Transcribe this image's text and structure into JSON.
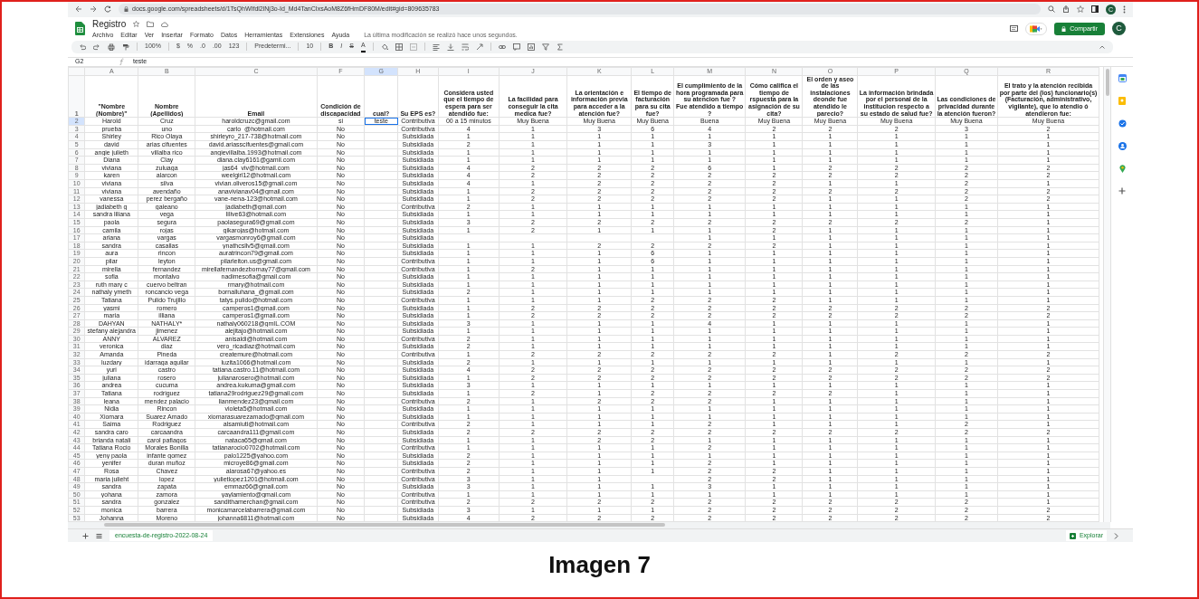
{
  "browser": {
    "url": "docs.google.com/spreadsheets/d/1TsQhWIfdl2lNj3o-Id_Md4TanCIxsAoM8Z6fHmDF80M/edit#gid=809635783",
    "profile_initial": "C"
  },
  "document": {
    "title": "Registro",
    "last_edit": "La última modificación se realizó hace unos segundos.",
    "share_button": "Compartir",
    "account_initial": "C"
  },
  "menu": [
    "Archivo",
    "Editar",
    "Ver",
    "Insertar",
    "Formato",
    "Datos",
    "Herramientas",
    "Extensiones",
    "Ayuda"
  ],
  "toolbar": {
    "zoom": "100%",
    "currency": "$",
    "percent": "%",
    "decimal_less": ".0",
    "decimal_more": ".00",
    "number_format": "123",
    "font": "Predetermi...",
    "font_size": "10",
    "bold": "B",
    "italic": "I",
    "strike": "S",
    "text_color": "A"
  },
  "formula_bar": {
    "cell": "G2",
    "value": "teste"
  },
  "header_row": "1",
  "columns": [
    {
      "letter": "A",
      "header": "\"Nombre (Nombre)\"",
      "selected": false
    },
    {
      "letter": "B",
      "header": "Nombre (Apellidos)",
      "selected": false
    },
    {
      "letter": "C",
      "header": "Email",
      "selected": false
    },
    {
      "letter": "F",
      "header": "Condición de discapacidad",
      "selected": false
    },
    {
      "letter": "G",
      "header": "cual?",
      "selected": true
    },
    {
      "letter": "H",
      "header": "Su EPS es?",
      "selected": false
    },
    {
      "letter": "I",
      "header": "Considera usted que el tiempo de espera para ser atendido fue:",
      "selected": false
    },
    {
      "letter": "J",
      "header": "La facilidad para conseguir la cita medica fue?",
      "selected": false
    },
    {
      "letter": "K",
      "header": "La orientación e información previa para acceder a la atención fue?",
      "selected": false
    },
    {
      "letter": "L",
      "header": "El tiempo de facturación para su cita fue?",
      "selected": false
    },
    {
      "letter": "M",
      "header": "El cumplimiento de la hora programada para su atencion fue ?\nFue atendido a tiempo ?",
      "selected": false
    },
    {
      "letter": "N",
      "header": "Cómo califica el tiempo de rspuesta para la asignación de su cita?",
      "selected": false
    },
    {
      "letter": "O",
      "header": "El orden y aseo de las instalaciones deonde fue atendido le parecio?",
      "selected": false
    },
    {
      "letter": "P",
      "header": "La información brindada por el personal de la institucion respecto a su estado de salud fue?",
      "selected": false
    },
    {
      "letter": "Q",
      "header": "Las condiciones de privacidad durante la atención fueron?",
      "selected": false
    },
    {
      "letter": "R",
      "header": "El trato y la atención recibida por parte del (los) funcionario(s) (Facturación, administrativo, vigilante), que lo atendio ó atendieron fue:",
      "selected": false
    }
  ],
  "rows": [
    {
      "number": "2",
      "selected": true,
      "cells": [
        "Harold",
        "Cruz",
        "haroldcruzc@gmail.com",
        "si",
        "teste",
        "Contributiva",
        "00 a 15 minutos",
        "Muy Buena",
        "Muy Buena",
        "Muy Buena",
        "Buena",
        "Muy Buena",
        "Muy Buena",
        "Muy Buena",
        "Muy Buena",
        "Muy Buena"
      ]
    },
    {
      "number": "3",
      "selected": false,
      "cells": [
        "prueba",
        "uno",
        "carlo_@hotmail.com",
        "No",
        null,
        "Contributiva",
        "4",
        "1",
        "3",
        "6",
        "4",
        "2",
        "2",
        "2",
        "3",
        "2"
      ]
    },
    {
      "number": "4",
      "selected": false,
      "cells": [
        "Shirley",
        "Rico Olaya",
        "shirleyro_217-738@hotmail.com",
        "No",
        null,
        "Subsidiada",
        "1",
        "1",
        "1",
        "1",
        "1",
        "1",
        "1",
        "1",
        "1",
        "1"
      ]
    },
    {
      "number": "5",
      "selected": false,
      "cells": [
        "david",
        "arias cifuentes",
        "david.ariasscifuentes@gmail.com",
        "No",
        null,
        "Subsidiada",
        "2",
        "1",
        "1",
        "1",
        "3",
        "1",
        "1",
        "1",
        "1",
        "1"
      ]
    },
    {
      "number": "6",
      "selected": false,
      "cells": [
        "angie julieth",
        "villalba rico",
        "angievillalba.1993@hotmail.com",
        "No",
        null,
        "Subsidiada",
        "1",
        "1",
        "1",
        "1",
        "1",
        "1",
        "1",
        "1",
        "1",
        "1"
      ]
    },
    {
      "number": "7",
      "selected": false,
      "cells": [
        "Diana",
        "Clay",
        "diana.clay6161@gamil.com",
        "No",
        null,
        "Subsidiada",
        "1",
        "1",
        "1",
        "1",
        "1",
        "1",
        "1",
        "1",
        "1",
        "1"
      ]
    },
    {
      "number": "8",
      "selected": false,
      "cells": [
        "viviana",
        "zuluaga",
        "jas64_viv@hotmail.com",
        "No",
        null,
        "Subsidiada",
        "4",
        "2",
        "2",
        "2",
        "6",
        "1",
        "2",
        "2",
        "2",
        "2"
      ]
    },
    {
      "number": "9",
      "selected": false,
      "cells": [
        "karen",
        "alarcon",
        "weelgirl12@hotmail.com",
        "No",
        null,
        "Subsidiada",
        "4",
        "2",
        "2",
        "2",
        "2",
        "2",
        "2",
        "2",
        "2",
        "2"
      ]
    },
    {
      "number": "10",
      "selected": false,
      "cells": [
        "viviana",
        "silva",
        "vivian.oliveros15@gmail.com",
        "No",
        null,
        "Subsidiada",
        "4",
        "1",
        "2",
        "2",
        "2",
        "2",
        "1",
        "1",
        "2",
        "1"
      ]
    },
    {
      "number": "11",
      "selected": false,
      "cells": [
        "viviana",
        "avendaño",
        "anavivianav04@gmail.com",
        "No",
        null,
        "Subsidiada",
        "1",
        "2",
        "2",
        "2",
        "2",
        "2",
        "2",
        "2",
        "2",
        "2"
      ]
    },
    {
      "number": "12",
      "selected": false,
      "cells": [
        "vanessa",
        "perez bergaño",
        "vane-nena-123@hotmail.com",
        "No",
        null,
        "Subsidiada",
        "1",
        "2",
        "2",
        "2",
        "2",
        "2",
        "1",
        "1",
        "2",
        "2"
      ]
    },
    {
      "number": "13",
      "selected": false,
      "cells": [
        "jadiabeth g",
        "galeano",
        "jadiabeth@gmail.com",
        "No",
        null,
        "Contributiva",
        "2",
        "1",
        "1",
        "1",
        "1",
        "1",
        "1",
        "1",
        "1",
        "1"
      ]
    },
    {
      "number": "14",
      "selected": false,
      "cells": [
        "sandra liliana",
        "vega",
        "lilive63@hotmail.com",
        "No",
        null,
        "Subsidiada",
        "1",
        "1",
        "1",
        "1",
        "1",
        "1",
        "1",
        "1",
        "1",
        "1"
      ]
    },
    {
      "number": "15",
      "selected": false,
      "cells": [
        "paola",
        "segura",
        "paolasegura69@gmail.com",
        "No",
        null,
        "Subsidiada",
        "3",
        "2",
        "2",
        "2",
        "2",
        "2",
        "2",
        "2",
        "2",
        "1"
      ]
    },
    {
      "number": "16",
      "selected": false,
      "cells": [
        "camila",
        "rojas",
        "gikarojas@hotmail.com",
        "No",
        null,
        "Subsidiada",
        "1",
        "2",
        "1",
        "1",
        "1",
        "2",
        "1",
        "1",
        "1",
        "1"
      ]
    },
    {
      "number": "17",
      "selected": false,
      "cells": [
        "ariana",
        "vargas",
        "vargasmonroy6@gmail.com",
        "No",
        null,
        "Subsidiada",
        null,
        null,
        null,
        null,
        "1",
        "1",
        "1",
        "1",
        "1",
        "1"
      ]
    },
    {
      "number": "18",
      "selected": false,
      "cells": [
        "sandra",
        "casallas",
        "ynathcsllv5@gmail.com",
        "No",
        null,
        "Subsidiada",
        "1",
        "1",
        "2",
        "2",
        "2",
        "2",
        "1",
        "1",
        "1",
        "1"
      ]
    },
    {
      "number": "19",
      "selected": false,
      "cells": [
        "aura",
        "rincon",
        "auratrincon79@gmail.com",
        "No",
        null,
        "Subsidiada",
        "1",
        "1",
        "1",
        "6",
        "1",
        "1",
        "1",
        "1",
        "1",
        "1"
      ]
    },
    {
      "number": "20",
      "selected": false,
      "cells": [
        "pilar",
        "leyton",
        "pilarleiton.us@gmail.com",
        "No",
        null,
        "Contributiva",
        "1",
        "1",
        "1",
        "6",
        "1",
        "1",
        "1",
        "1",
        "1",
        "1"
      ]
    },
    {
      "number": "21",
      "selected": false,
      "cells": [
        "mirella",
        "fernandez",
        "mirellafernandezbornay77@gmail.com",
        "No",
        null,
        "Contributiva",
        "1",
        "2",
        "1",
        "1",
        "1",
        "1",
        "1",
        "1",
        "1",
        "1"
      ]
    },
    {
      "number": "22",
      "selected": false,
      "cells": [
        "sofia",
        "montalvo",
        "nadimesofia@gmail.com",
        "No",
        null,
        "Subsidiada",
        "1",
        "1",
        "1",
        "1",
        "1",
        "1",
        "1",
        "1",
        "1",
        "1"
      ]
    },
    {
      "number": "23",
      "selected": false,
      "cells": [
        "ruth mary c",
        "cuervo beltran",
        "rmary@hotmail.com",
        "No",
        null,
        "Subsidiada",
        "1",
        "1",
        "1",
        "1",
        "1",
        "1",
        "1",
        "1",
        "1",
        "1"
      ]
    },
    {
      "number": "24",
      "selected": false,
      "cells": [
        "nathaly ymeth",
        "roncancio vega",
        "bornalluhana_@gmail.com",
        "No",
        null,
        "Subsidiada",
        "2",
        "1",
        "1",
        "1",
        "1",
        "1",
        "1",
        "1",
        "1",
        "1"
      ]
    },
    {
      "number": "25",
      "selected": false,
      "cells": [
        "Tatiana",
        "Pulido Trujillo",
        "tatys.pulido@hotmail.com",
        "No",
        null,
        "Contributiva",
        "1",
        "1",
        "1",
        "2",
        "2",
        "2",
        "1",
        "1",
        "1",
        "1"
      ]
    },
    {
      "number": "26",
      "selected": false,
      "cells": [
        "yasmi",
        "romero",
        "camperos1@gmail.com",
        "No",
        null,
        "Subsidiada",
        "1",
        "2",
        "2",
        "2",
        "2",
        "2",
        "2",
        "2",
        "2",
        "2"
      ]
    },
    {
      "number": "27",
      "selected": false,
      "cells": [
        "maria",
        "illiana",
        "camperos1@gmail.com",
        "No",
        null,
        "Subsidiada",
        "1",
        "2",
        "2",
        "2",
        "2",
        "2",
        "2",
        "2",
        "2",
        "2"
      ]
    },
    {
      "number": "28",
      "selected": false,
      "cells": [
        "DAHYAN",
        "NATHALY*",
        "nathaly060218@gmIL.COM",
        "No",
        null,
        "Subsidiada",
        "3",
        "1",
        "1",
        "1",
        "4",
        "1",
        "1",
        "1",
        "1",
        "1"
      ]
    },
    {
      "number": "29",
      "selected": false,
      "cells": [
        "stefany alejandra",
        "jimenez",
        "alejitajo@hotmail.com",
        "No",
        null,
        "Subsidiada",
        "1",
        "1",
        "1",
        "1",
        "1",
        "1",
        "1",
        "1",
        "1",
        "1"
      ]
    },
    {
      "number": "30",
      "selected": false,
      "cells": [
        "ANNY",
        "ALVAREZ",
        "anisaldi@hotmail.com",
        "No",
        null,
        "Contributiva",
        "2",
        "1",
        "1",
        "1",
        "1",
        "1",
        "1",
        "1",
        "1",
        "1"
      ]
    },
    {
      "number": "31",
      "selected": false,
      "cells": [
        "veronica",
        "diaz",
        "vero_ricadiaz@hotmail.com",
        "No",
        null,
        "Subsidiada",
        "2",
        "1",
        "1",
        "1",
        "1",
        "1",
        "1",
        "1",
        "1",
        "1"
      ]
    },
    {
      "number": "32",
      "selected": false,
      "cells": [
        "Amanda",
        "Pineda",
        "createmure@hotmail.com",
        "No",
        null,
        "Contributiva",
        "1",
        "2",
        "2",
        "2",
        "2",
        "2",
        "1",
        "2",
        "2",
        "2"
      ]
    },
    {
      "number": "33",
      "selected": false,
      "cells": [
        "luzdary",
        "idarraga aguilar",
        "luzita1066@hotmail.com",
        "No",
        null,
        "Subsidiada",
        "2",
        "1",
        "1",
        "1",
        "1",
        "1",
        "1",
        "1",
        "1",
        "1"
      ]
    },
    {
      "number": "34",
      "selected": false,
      "cells": [
        "yuri",
        "castro",
        "tatiana.castro.11@hotmail.com",
        "No",
        null,
        "Subsidiada",
        "4",
        "2",
        "2",
        "2",
        "2",
        "2",
        "2",
        "2",
        "2",
        "2"
      ]
    },
    {
      "number": "35",
      "selected": false,
      "cells": [
        "juliana",
        "rosero",
        "julianarosero@hotmail.com",
        "No",
        null,
        "Subsidiada",
        "1",
        "2",
        "2",
        "2",
        "2",
        "2",
        "2",
        "2",
        "2",
        "2"
      ]
    },
    {
      "number": "36",
      "selected": false,
      "cells": [
        "andrea",
        "cucuma",
        "andrea.kukuma@gmail.com",
        "No",
        null,
        "Subsidiada",
        "3",
        "1",
        "1",
        "1",
        "1",
        "1",
        "1",
        "1",
        "1",
        "1"
      ]
    },
    {
      "number": "37",
      "selected": false,
      "cells": [
        "Tatiana",
        "rodriguez",
        "tatiana29rodriguez29@gmail.com",
        "No",
        null,
        "Subsidiada",
        "1",
        "2",
        "1",
        "2",
        "2",
        "2",
        "2",
        "1",
        "1",
        "1"
      ]
    },
    {
      "number": "38",
      "selected": false,
      "cells": [
        "leana",
        "mendez palacio",
        "lianmendez23@gmail.com",
        "No",
        null,
        "Contributiva",
        "2",
        "1",
        "2",
        "2",
        "2",
        "1",
        "1",
        "1",
        "1",
        "1"
      ]
    },
    {
      "number": "39",
      "selected": false,
      "cells": [
        "Nidia",
        "Rincon",
        "violeta5@hotmail.com",
        "No",
        null,
        "Subsidiada",
        "1",
        "1",
        "1",
        "1",
        "1",
        "1",
        "1",
        "1",
        "1",
        "1"
      ]
    },
    {
      "number": "40",
      "selected": false,
      "cells": [
        "Xiomara",
        "Suarez Amado",
        "xiomarasuarezamado@gmail.com",
        "No",
        null,
        "Subsidiada",
        "1",
        "1",
        "1",
        "1",
        "1",
        "1",
        "1",
        "1",
        "1",
        "1"
      ]
    },
    {
      "number": "41",
      "selected": false,
      "cells": [
        "Saima",
        "Rodriguez",
        "alsamiuti@hotmail.com",
        "No",
        null,
        "Contributiva",
        "2",
        "1",
        "1",
        "1",
        "2",
        "1",
        "1",
        "1",
        "2",
        "1"
      ]
    },
    {
      "number": "42",
      "selected": false,
      "cells": [
        "sandra caro",
        "carcaandra",
        "carcaandra111@gmail.com",
        "No",
        null,
        "Subsidiada",
        "2",
        "2",
        "2",
        "2",
        "2",
        "2",
        "2",
        "2",
        "2",
        "2"
      ]
    },
    {
      "number": "43",
      "selected": false,
      "cells": [
        "brianda natali",
        "carol pafiagos",
        "nataca65@gmail.com",
        "No",
        null,
        "Subsidiada",
        "1",
        "1",
        "2",
        "2",
        "1",
        "1",
        "1",
        "1",
        "1",
        "1"
      ]
    },
    {
      "number": "44",
      "selected": false,
      "cells": [
        "Tatiana Rocio",
        "Morales Bonilla",
        "tatianarocio0702@hotmail.com",
        "No",
        null,
        "Contributiva",
        "1",
        "1",
        "1",
        "1",
        "2",
        "1",
        "1",
        "1",
        "1",
        "1"
      ]
    },
    {
      "number": "45",
      "selected": false,
      "cells": [
        "yeny paola",
        "infante gomez",
        "palo1225@yahoo.com",
        "No",
        null,
        "Subsidiada",
        "2",
        "1",
        "1",
        "1",
        "1",
        "1",
        "1",
        "1",
        "1",
        "1"
      ]
    },
    {
      "number": "46",
      "selected": false,
      "cells": [
        "yenifer",
        "duran muñoz",
        "microye86@gmail.com",
        "No",
        null,
        "Subsidiada",
        "2",
        "1",
        "1",
        "1",
        "2",
        "1",
        "1",
        "1",
        "1",
        "1"
      ]
    },
    {
      "number": "47",
      "selected": false,
      "cells": [
        "Rosa",
        "Chavez",
        "alarosa67@yahoo.es",
        "No",
        null,
        "Contributiva",
        "2",
        "1",
        "1",
        "1",
        "2",
        "2",
        "1",
        "1",
        "1",
        "1"
      ]
    },
    {
      "number": "48",
      "selected": false,
      "cells": [
        "maria julieht",
        "lopez",
        "yulietlopez1201@hotmail.com",
        "No",
        null,
        "Contributiva",
        "3",
        "1",
        "1",
        null,
        "2",
        "2",
        "1",
        "1",
        "1",
        "1"
      ]
    },
    {
      "number": "49",
      "selected": false,
      "cells": [
        "sandra",
        "zapata",
        "emmaz66@gmail.com",
        "No",
        null,
        "Subsidiada",
        "3",
        "1",
        "1",
        "1",
        "3",
        "1",
        "1",
        "1",
        "1",
        "1"
      ]
    },
    {
      "number": "50",
      "selected": false,
      "cells": [
        "yohana",
        "zamora",
        "yaylamiento@gmail.com",
        "No",
        null,
        "Contributiva",
        "1",
        "1",
        "1",
        "1",
        "1",
        "1",
        "1",
        "1",
        "1",
        "1"
      ]
    },
    {
      "number": "51",
      "selected": false,
      "cells": [
        "sandra",
        "gonzalez",
        "sandithamerchan@gmail.com",
        "No",
        null,
        "Contributiva",
        "2",
        "2",
        "2",
        "2",
        "2",
        "2",
        "2",
        "2",
        "2",
        "1"
      ]
    },
    {
      "number": "52",
      "selected": false,
      "cells": [
        "monica",
        "barrera",
        "monicamarcelabarrera@gmail.com",
        "No",
        null,
        "Subsidiada",
        "3",
        "1",
        "1",
        "1",
        "2",
        "2",
        "2",
        "2",
        "2",
        "2"
      ]
    },
    {
      "number": "53",
      "selected": false,
      "cells": [
        "Johanna",
        "Moreno",
        "johanna6811@hotmail.com",
        "No",
        null,
        "Subsidiada",
        "4",
        "2",
        "2",
        "2",
        "2",
        "2",
        "2",
        "2",
        "2",
        "2"
      ]
    }
  ],
  "sheets": [
    {
      "label": "encuesta-de-registro-2022-08-24",
      "selected": true
    }
  ],
  "explore_button": "Explorar",
  "caption": "Imagen 7"
}
